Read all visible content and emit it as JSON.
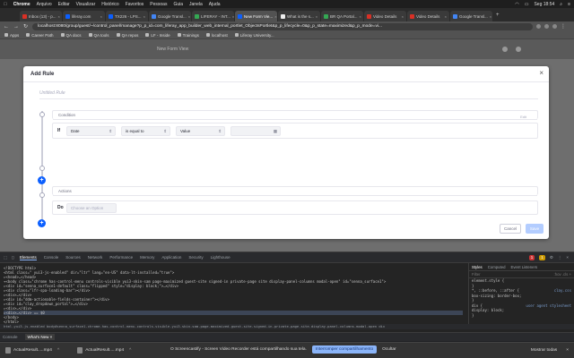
{
  "menubar": {
    "apple": "",
    "app": "Chrome",
    "items": [
      "Arquivo",
      "Editar",
      "Visualizar",
      "Histórico",
      "Favoritos",
      "Pessoas",
      "Guia",
      "Janela",
      "Ajuda"
    ],
    "clock": "Seg 18:54"
  },
  "tabs": [
    {
      "label": "Inbox (13) - p...",
      "color": "#d93025",
      "active": false
    },
    {
      "label": "liferay.com",
      "color": "#0b5fff",
      "active": false
    },
    {
      "label": "TX226 - LPS...",
      "color": "#0b5fff",
      "active": false
    },
    {
      "label": "Google Transl...",
      "color": "#4285f4",
      "active": false
    },
    {
      "label": "LIFERAY - INT...",
      "color": "#34a853",
      "active": false
    },
    {
      "label": "New Form Vie...",
      "color": "#0b5fff",
      "active": true
    },
    {
      "label": "What is the s...",
      "color": "#eeeeee",
      "active": false
    },
    {
      "label": "BR QA Portal...",
      "color": "#34a853",
      "active": false
    },
    {
      "label": "Video Details",
      "color": "#d93025",
      "active": false
    },
    {
      "label": "Video Details",
      "color": "#d93025",
      "active": false
    },
    {
      "label": "Google Transl...",
      "color": "#4285f4",
      "active": false
    }
  ],
  "address": {
    "url": "localhost:8080/group/guest/~/control_panel/manage?p_p_id=com_liferay_app_builder_web_internal_portlet_ObjectsPortlet&p_p_lifecycle=0&p_p_state=maximized&p_p_mode=vi..."
  },
  "bookmarks": [
    "Apps",
    "Career Path",
    "QA docs",
    "QA tools",
    "QA repos",
    "LF - Inside",
    "Trainings",
    "localhost",
    "Liferay University..."
  ],
  "page": {
    "header_title": "New Form View"
  },
  "modal": {
    "title": "Add Rule",
    "close": "×",
    "rule_name_placeholder": "Untitled Rule",
    "condition": {
      "heading": "Condition",
      "edit_label": "Edit",
      "if_label": "If",
      "field": "Date",
      "operator": "is equal to",
      "value_type": "Value",
      "value": ""
    },
    "actions": {
      "heading": "Actions",
      "do_label": "Do",
      "action_placeholder": "Choose an Option"
    },
    "cancel_label": "Cancel",
    "save_label": "Save",
    "accent": "#0b5fff"
  },
  "devtools": {
    "tabs": [
      "Elements",
      "Console",
      "Sources",
      "Network",
      "Performance",
      "Memory",
      "Application",
      "Security",
      "Lighthouse"
    ],
    "active_tab": "Elements",
    "error_count": "1",
    "warning_count": "1",
    "elements_lines": [
      "<!DOCTYPE html>",
      "<html class=\" yui3-js-enabled\" dir=\"ltr\" lang=\"en-US\" data-lt-installed=\"true\">",
      "▸<head>…</head>",
      "▾<body class=\"chrome has-control-menu controls-visible yui3-skin-sam page-maximized guest-site signed-in private-page site display-panel-columns modal-open\" id=\"senna_surface1\">",
      "  ▸<div id=\"senna_surface1-default\" class=\"flipped\" style=\"display: block;\">…</div>",
      "  ▸<div class=\"lfr-spa-loading-bar\"></div>",
      "  ▸<div>…</div>",
      "  ▸<div id=\"ddm-actionable-fields-container\"></div>",
      "  ▸<div id=\"clay_dropdown_portal\">…</div>",
      "  ▸<div>…</div>",
      "  ▸<div>…</div> == $0",
      "  </body>",
      "</html>"
    ],
    "styles_tabs": [
      "Styles",
      "Computed",
      "Event Listeners"
    ],
    "styles_filter": "Filter",
    "styles_filter_right": ":hov .cls +",
    "styles_rules": [
      {
        "text": "element.style {",
        "src": ""
      },
      {
        "text": "}",
        "src": ""
      },
      {
        "text": "*, ::before, ::after {",
        "src": "clay.css"
      },
      {
        "text": "  box-sizing: border-box;",
        "src": ""
      },
      {
        "text": "}",
        "src": ""
      },
      {
        "text": "div {",
        "src": "user agent stylesheet"
      },
      {
        "text": "  display: block;",
        "src": ""
      },
      {
        "text": "}",
        "src": ""
      }
    ],
    "breadcrumb": "html.yui3-js-enabled   body#senna_surface1.chrome.has-control-menu.controls-visible.yui3-skin-sam.page-maximized.guest-site.signed-in.private-page.site.display-panel-columns.modal-open   div",
    "drawer_tabs": [
      "Console",
      "What's New ×"
    ],
    "drawer_active": "What's New ×"
  },
  "sharebar": {
    "message": "O Screencastify - Screen Video Recorder está compartilhando sua tela.",
    "stop": "Interromper compartilhamento",
    "hide": "Ocultar"
  },
  "downloads": {
    "items": [
      "ActualResult.....mp4",
      "ActualResult.....mp4"
    ],
    "show_all": "Mostrar todas",
    "close": "×"
  }
}
